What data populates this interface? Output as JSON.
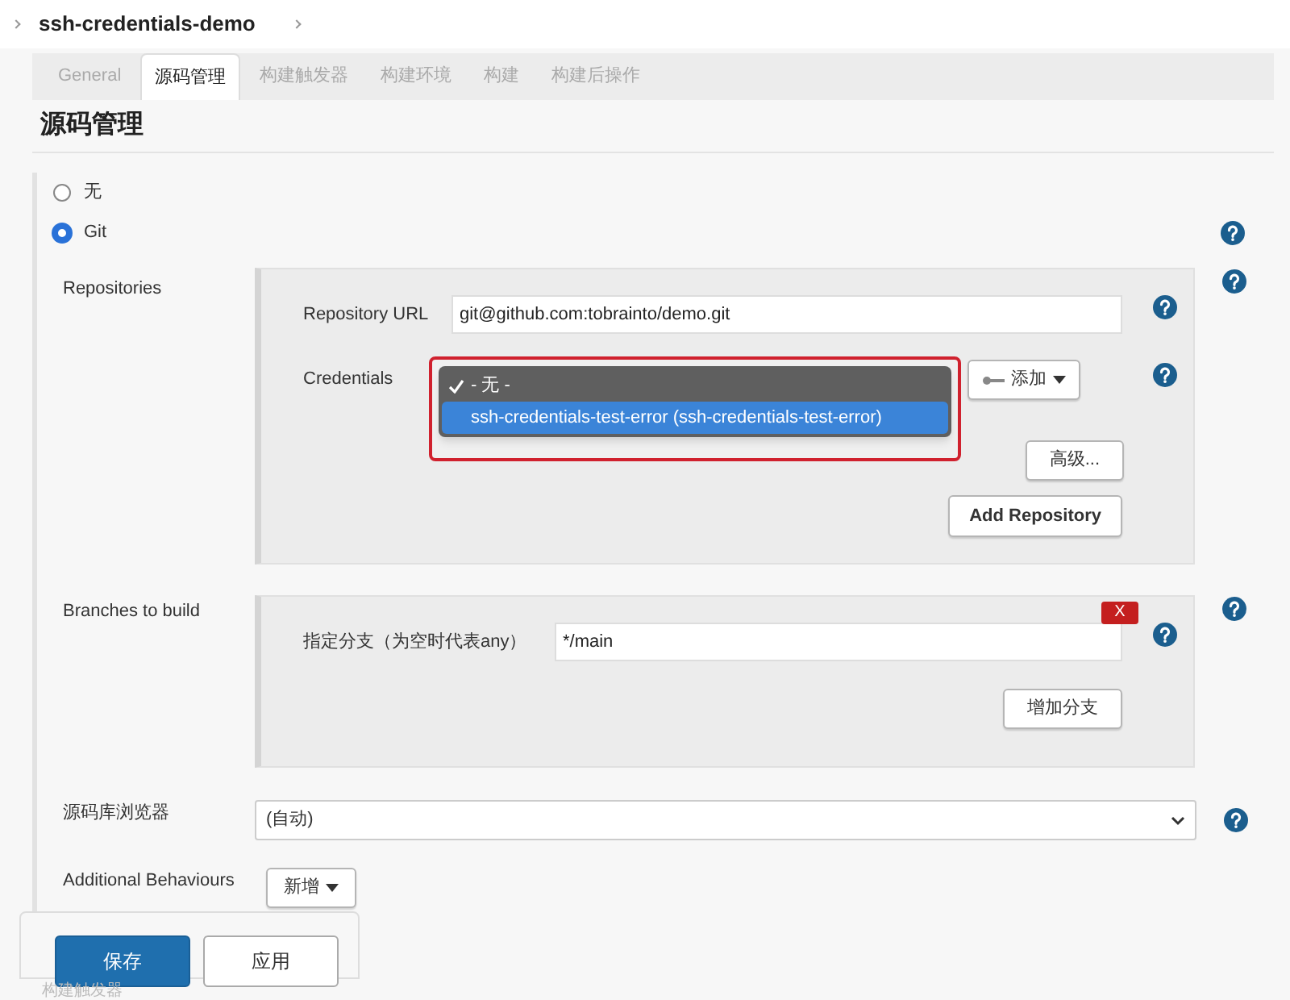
{
  "breadcrumb": {
    "project": "ssh-credentials-demo"
  },
  "tabs": [
    {
      "label": "General",
      "selected": false
    },
    {
      "label": "源码管理",
      "selected": true
    },
    {
      "label": "构建触发器",
      "selected": false
    },
    {
      "label": "构建环境",
      "selected": false
    },
    {
      "label": "构建",
      "selected": false
    },
    {
      "label": "构建后操作",
      "selected": false
    }
  ],
  "section_title": "源码管理",
  "scm_options": [
    {
      "label": "无",
      "selected": false
    },
    {
      "label": "Git",
      "selected": true
    }
  ],
  "repositories": {
    "label": "Repositories",
    "url_label": "Repository URL",
    "url_value": "git@github.com:tobrainto/demo.git",
    "credentials_label": "Credentials",
    "credentials_options": [
      {
        "label": "- 无 -",
        "checked": true,
        "selected": false
      },
      {
        "label": "ssh-credentials-test-error (ssh-credentials-test-error)",
        "checked": false,
        "selected": true
      }
    ],
    "add_button": "添加",
    "advanced_button": "高级...",
    "add_repository_button": "Add Repository"
  },
  "branches": {
    "label": "Branches to build",
    "delete_button": "X",
    "branch_label": "指定分支（为空时代表any）",
    "branch_value": "*/main",
    "add_branch_button": "增加分支"
  },
  "repo_browser": {
    "label": "源码库浏览器",
    "value": "(自动)"
  },
  "additional_behaviours": {
    "label": "Additional Behaviours",
    "add_button": "新增"
  },
  "actions": [
    {
      "label": "保存",
      "kind": "primary"
    },
    {
      "label": "应用",
      "kind": "secondary"
    }
  ],
  "next_section_title": "构建触发器"
}
